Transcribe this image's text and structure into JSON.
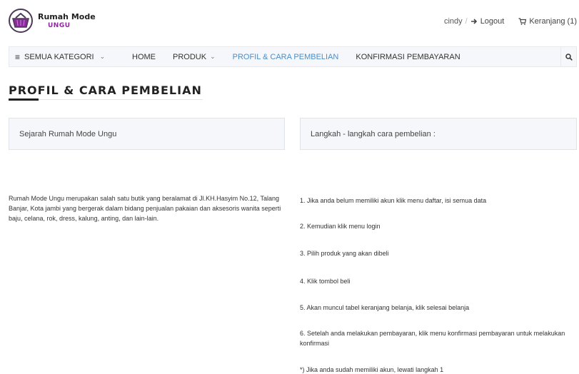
{
  "header": {
    "logo_title": "Rumah Mode",
    "logo_subtitle": "UNGU",
    "user": "cindy",
    "separator": "/",
    "logout_label": "Logout",
    "cart_label": "Keranjang (1)"
  },
  "nav": {
    "category_label": "SEMUA KATEGORI",
    "items": [
      {
        "label": "HOME"
      },
      {
        "label": "PRODUK"
      },
      {
        "label": "PROFIL & CARA PEMBELIAN"
      },
      {
        "label": "KONFIRMASI PEMBAYARAN"
      }
    ],
    "active_index": 2
  },
  "page": {
    "title": "PROFIL & CARA PEMBELIAN"
  },
  "left_panel": {
    "heading": "Sejarah Rumah Mode Ungu",
    "body": "Rumah Mode Ungu merupakan salah satu butik yang beralamat di Jl.KH.Hasyim No.12, Talang Banjar, Kota jambi yang bergerak dalam bidang penjualan pakaian dan aksesoris wanita seperti baju, celana, rok, dress, kalung, anting, dan lain-lain."
  },
  "right_panel": {
    "heading": "Langkah - langkah cara pembelian :",
    "steps": [
      "1. Jika anda belum memiliki akun klik menu daftar, isi semua data",
      "2. Kemudian klik menu login",
      "3. Pilih produk yang akan dibeli",
      "4. Klik tombol beli",
      "5. Akan muncul tabel keranjang belanja, klik selesai belanja",
      "6. Setelah anda melakukan pembayaran, klik menu konfirmasi pembayaran untuk melakukan konfirmasi",
      "*) Jika anda sudah memiliki akun, lewati langkah 1"
    ]
  },
  "colors": {
    "accent": "#4a8ec9",
    "brand_purple": "#8a2a9b",
    "nav_bg": "#f5f7fa",
    "panel_bg": "#f5f7fa"
  },
  "icons": {
    "logo": "shopping-basket-icon",
    "logout": "arrow-right-icon",
    "cart": "cart-icon",
    "menu": "hamburger-icon",
    "dropdown": "chevron-down-icon",
    "search": "search-icon"
  }
}
